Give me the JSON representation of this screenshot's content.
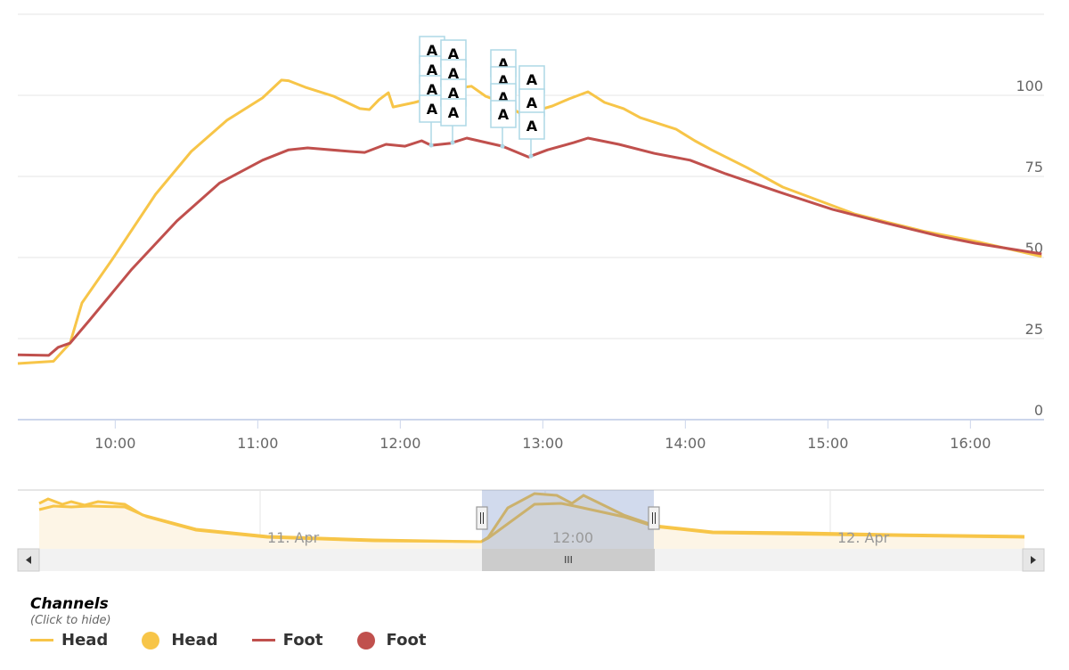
{
  "chart_data": {
    "type": "line",
    "title": "",
    "xlabel": "",
    "ylabel": "",
    "y_axis_side": "right",
    "ylim": [
      0,
      125
    ],
    "yticks": [
      "0",
      "25",
      "50",
      "75",
      "100"
    ],
    "xlim": [
      "09:19",
      "16:31"
    ],
    "xticks": [
      "10:00",
      "11:00",
      "12:00",
      "13:00",
      "14:00",
      "15:00",
      "16:00"
    ],
    "grid": true,
    "series": [
      {
        "name": "Head",
        "color": "#f7c548",
        "points": [
          [
            "09:19",
            17.3
          ],
          [
            "09:34",
            18
          ],
          [
            "09:41",
            23.6
          ],
          [
            "09:46",
            36
          ],
          [
            "09:59",
            49.7
          ],
          [
            "10:17",
            69.5
          ],
          [
            "10:32",
            82.7
          ],
          [
            "10:47",
            92.3
          ],
          [
            "11:02",
            99.2
          ],
          [
            "11:10",
            104.7
          ],
          [
            "11:13",
            104.5
          ],
          [
            "11:20",
            102.5
          ],
          [
            "11:32",
            99.7
          ],
          [
            "11:43",
            95.9
          ],
          [
            "11:47",
            95.6
          ],
          [
            "11:51",
            98.6
          ],
          [
            "11:55",
            100.8
          ],
          [
            "11:57",
            96.4
          ],
          [
            "12:06",
            97.8
          ],
          [
            "12:13",
            99.2
          ],
          [
            "12:17",
            100.5
          ],
          [
            "12:27",
            102.5
          ],
          [
            "12:30",
            102.8
          ],
          [
            "12:36",
            99.7
          ],
          [
            "12:43",
            97.8
          ],
          [
            "12:51",
            94.2
          ],
          [
            "12:56",
            95
          ],
          [
            "13:04",
            96.7
          ],
          [
            "13:11",
            98.9
          ],
          [
            "13:19",
            101.1
          ],
          [
            "13:26",
            97.8
          ],
          [
            "13:34",
            95.9
          ],
          [
            "13:41",
            93.1
          ],
          [
            "13:56",
            89.6
          ],
          [
            "14:04",
            86
          ],
          [
            "14:11",
            83.2
          ],
          [
            "14:26",
            77.7
          ],
          [
            "14:41",
            71.7
          ],
          [
            "14:56",
            67.6
          ],
          [
            "15:11",
            63.5
          ],
          [
            "15:26",
            60.7
          ],
          [
            "15:41",
            58
          ],
          [
            "16:04",
            54.7
          ],
          [
            "16:30",
            50.3
          ]
        ]
      },
      {
        "name": "Foot",
        "color": "#c0504d",
        "points": [
          [
            "09:19",
            20
          ],
          [
            "09:32",
            19.8
          ],
          [
            "09:36",
            22.3
          ],
          [
            "09:41",
            23.6
          ],
          [
            "09:49",
            30.5
          ],
          [
            "10:07",
            46.4
          ],
          [
            "10:26",
            61.3
          ],
          [
            "10:44",
            73
          ],
          [
            "11:02",
            80
          ],
          [
            "11:13",
            83.2
          ],
          [
            "11:21",
            83.8
          ],
          [
            "11:39",
            82.7
          ],
          [
            "11:45",
            82.4
          ],
          [
            "11:54",
            84.9
          ],
          [
            "12:02",
            84.3
          ],
          [
            "12:09",
            86
          ],
          [
            "12:13",
            84.6
          ],
          [
            "12:21",
            85.2
          ],
          [
            "12:28",
            86.8
          ],
          [
            "12:43",
            84.3
          ],
          [
            "12:54",
            81
          ],
          [
            "13:02",
            83.2
          ],
          [
            "13:13",
            85.4
          ],
          [
            "13:19",
            86.8
          ],
          [
            "13:32",
            84.9
          ],
          [
            "13:47",
            82.1
          ],
          [
            "14:02",
            80
          ],
          [
            "14:17",
            75.8
          ],
          [
            "14:39",
            70.3
          ],
          [
            "15:02",
            64.8
          ],
          [
            "15:24",
            60.7
          ],
          [
            "15:47",
            56.6
          ],
          [
            "16:02",
            54.4
          ],
          [
            "16:30",
            51.1
          ]
        ]
      }
    ],
    "flags": {
      "label": "A",
      "groups": [
        {
          "time": "12:13",
          "series": "Foot",
          "count": 4
        },
        {
          "time": "12:22",
          "series": "Foot",
          "count": 4
        },
        {
          "time": "12:43",
          "series": "Foot",
          "count": 4
        },
        {
          "time": "12:55",
          "series": "Foot",
          "count": 3
        }
      ]
    },
    "navigator": {
      "labels": [
        "11. Apr",
        "12:00",
        "12. Apr"
      ],
      "selected_range": [
        "09:19",
        "16:31"
      ],
      "scrollbar_grip": "III",
      "handle_glyph": "||"
    }
  },
  "legend": {
    "title": "Channels",
    "subtitle": "(Click to hide)",
    "items": [
      {
        "label": "Head",
        "symbol": "line",
        "color": "#f7c548"
      },
      {
        "label": "Head",
        "symbol": "dot",
        "color": "#f7c548"
      },
      {
        "label": "Foot",
        "symbol": "line",
        "color": "#c0504d"
      },
      {
        "label": "Foot",
        "symbol": "dot",
        "color": "#c0504d"
      }
    ]
  }
}
